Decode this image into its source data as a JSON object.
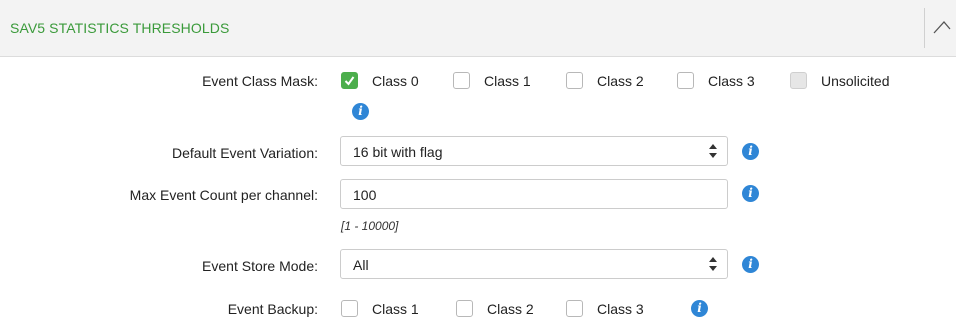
{
  "panel": {
    "title": "SAV5 STATISTICS THRESHOLDS"
  },
  "event_class_mask": {
    "label": "Event Class Mask:",
    "options": [
      {
        "label": "Class 0",
        "checked": true
      },
      {
        "label": "Class 1",
        "checked": false
      },
      {
        "label": "Class 2",
        "checked": false
      },
      {
        "label": "Class 3",
        "checked": false
      },
      {
        "label": "Unsolicited",
        "checked": false,
        "disabled": true
      }
    ]
  },
  "default_event_variation": {
    "label": "Default Event Variation:",
    "value": "16 bit with flag"
  },
  "max_event_count": {
    "label": "Max Event Count per channel:",
    "value": "100",
    "range_hint": "[1 - 10000]"
  },
  "event_store_mode": {
    "label": "Event Store Mode:",
    "value": "All"
  },
  "event_backup": {
    "label": "Event Backup:",
    "options": [
      {
        "label": "Class 1",
        "checked": false
      },
      {
        "label": "Class 2",
        "checked": false
      },
      {
        "label": "Class 3",
        "checked": false
      }
    ]
  },
  "colors": {
    "title_green": "#3a9a3a",
    "checkbox_green": "#4cae4c",
    "info_blue": "#2f86d6"
  },
  "icons": {
    "info": "info-icon",
    "collapse": "chevron-up-icon",
    "select_arrows": "sort-arrows-icon"
  }
}
